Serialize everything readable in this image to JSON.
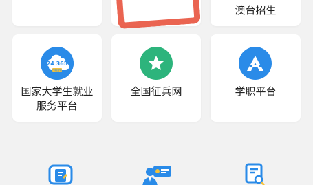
{
  "colors": {
    "page_bg": "#f2f2f2",
    "card_bg": "#ffffff",
    "highlight": "#e8543f",
    "green": "#2db47c",
    "blue": "#2a8be8"
  },
  "top_row": {
    "left_partial": "",
    "middle_partial": "",
    "right_partial_line1": "",
    "right_partial_line2": "澳台招生"
  },
  "cards": [
    {
      "icon": "cloud-24365-icon",
      "icon_text_top": "24 365",
      "icon_text_bottom": "一路为你",
      "label_line1": "国家大学生就业",
      "label_line2": "服务平台"
    },
    {
      "icon": "star-icon",
      "label_line1": "全国征兵网"
    },
    {
      "icon": "a-logo-icon",
      "label_line1": "学职平台"
    }
  ],
  "bottom_icons": [
    "document-edit-icon",
    "person-presentation-icon",
    "certificate-search-icon"
  ]
}
